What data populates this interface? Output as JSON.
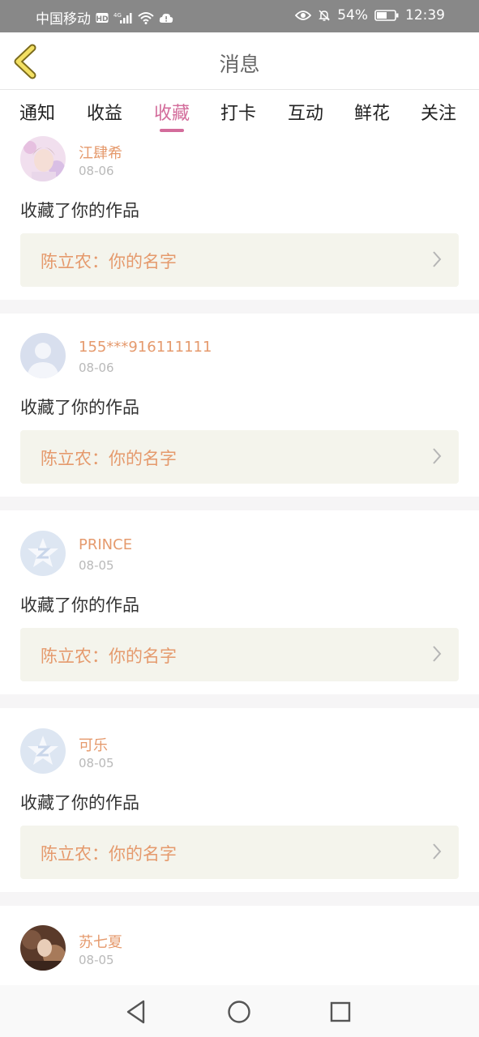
{
  "status_bar": {
    "carrier": "中国移动",
    "battery": "54%",
    "time": "12:39"
  },
  "header": {
    "title": "消息",
    "back_icon": "chevron-left-icon"
  },
  "tabs": [
    {
      "label": "通知",
      "active": false
    },
    {
      "label": "收益",
      "active": false
    },
    {
      "label": "收藏",
      "active": true
    },
    {
      "label": "打卡",
      "active": false
    },
    {
      "label": "互动",
      "active": false
    },
    {
      "label": "鲜花",
      "active": false
    },
    {
      "label": "关注",
      "active": false
    }
  ],
  "messages": [
    {
      "name": "江肆希",
      "date": "08-06",
      "action": "收藏了你的作品",
      "work": "陈立农：你的名字",
      "avatar": "photo-pink"
    },
    {
      "name": "155***916111111",
      "date": "08-06",
      "action": "收藏了你的作品",
      "work": "陈立农：你的名字",
      "avatar": "default-person"
    },
    {
      "name": "PRINCE",
      "date": "08-05",
      "action": "收藏了你的作品",
      "work": "陈立农：你的名字",
      "avatar": "default-qzone"
    },
    {
      "name": "可乐",
      "date": "08-05",
      "action": "收藏了你的作品",
      "work": "陈立农：你的名字",
      "avatar": "default-qzone"
    },
    {
      "name": "苏七夏",
      "date": "08-05",
      "action": "",
      "work": "",
      "avatar": "photo-dark"
    }
  ],
  "colors": {
    "accent": "#d36c9b",
    "name": "#e59a6d",
    "work_bg": "#f4f4ec"
  }
}
